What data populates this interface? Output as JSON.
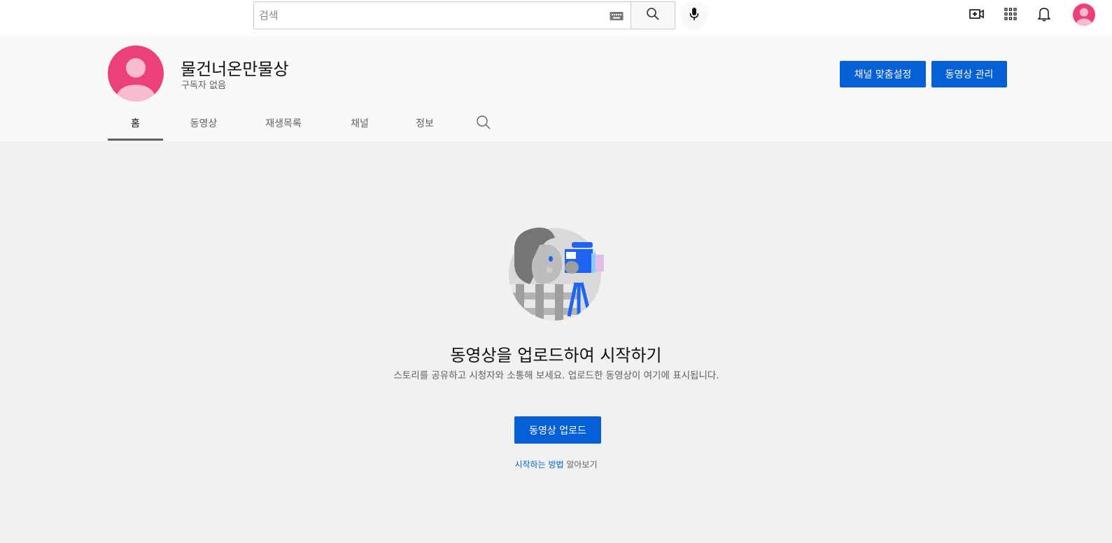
{
  "search": {
    "placeholder": "검색"
  },
  "channel": {
    "name": "물건너온만물상",
    "subscribers": "구독자 없음",
    "customize_label": "채널 맞춤설정",
    "manage_label": "동영상 관리"
  },
  "tabs": [
    {
      "label": "홈",
      "active": true
    },
    {
      "label": "동영상"
    },
    {
      "label": "재생목록"
    },
    {
      "label": "채널"
    },
    {
      "label": "정보"
    }
  ],
  "empty_state": {
    "title": "동영상을 업로드하여 시작하기",
    "description": "스토리를 공유하고 시청자와 소통해 보세요. 업로드한 동영상이 여기에 표시됩니다.",
    "upload_label": "동영상 업로드",
    "learn_link": "시작하는 방법",
    "learn_suffix": " 알아보기"
  },
  "colors": {
    "accent": "#065fd4",
    "avatar": "#ec407a"
  },
  "icons": [
    "keyboard-icon",
    "search-icon",
    "mic-icon",
    "create-video-icon",
    "apps-icon",
    "bell-icon"
  ]
}
